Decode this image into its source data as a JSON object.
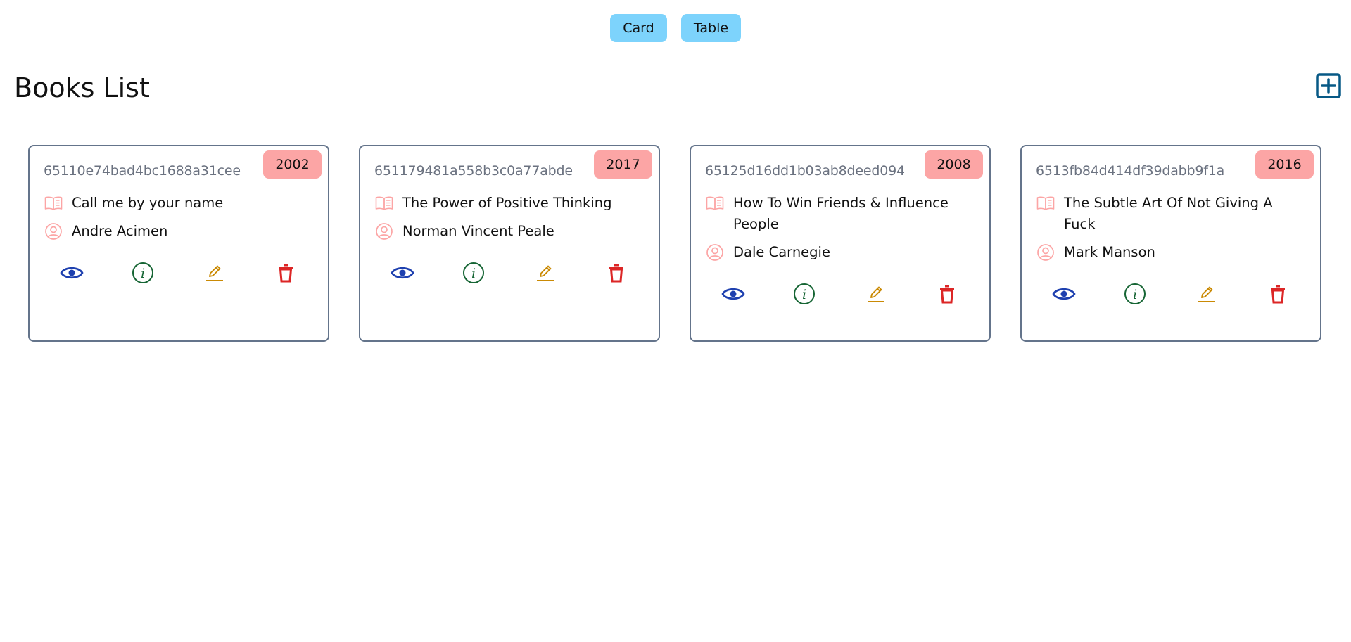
{
  "view_toggle": {
    "card_label": "Card",
    "table_label": "Table"
  },
  "page": {
    "title": "Books List",
    "add_icon": "plus-square-icon"
  },
  "colors": {
    "toggle_bg": "#7dd3fc",
    "badge_bg": "#fca5a5",
    "view_icon": "#1e40af",
    "info_icon": "#166534",
    "edit_icon": "#ca8a04",
    "delete_icon": "#dc2626",
    "add_icon": "#075985"
  },
  "books": [
    {
      "id": "65110e74bad4bc1688a31cee",
      "year": "2002",
      "title": "Call me by your name",
      "author": "Andre Acimen"
    },
    {
      "id": "651179481a558b3c0a77abde",
      "year": "2017",
      "title": "The Power of Positive Thinking",
      "author": "Norman Vincent Peale"
    },
    {
      "id": "65125d16dd1b03ab8deed094",
      "year": "2008",
      "title": "How To Win Friends & Influence People",
      "author": "Dale Carnegie"
    },
    {
      "id": "6513fb84d414df39dabb9f1a",
      "year": "2016",
      "title": "The Subtle Art Of Not Giving A Fuck",
      "author": "Mark Manson"
    }
  ],
  "card_icons": {
    "title_icon": "book-open-icon",
    "author_icon": "user-circle-icon",
    "view_icon": "eye-icon",
    "info_icon": "info-circle-icon",
    "edit_icon": "pencil-icon",
    "delete_icon": "trash-icon"
  }
}
